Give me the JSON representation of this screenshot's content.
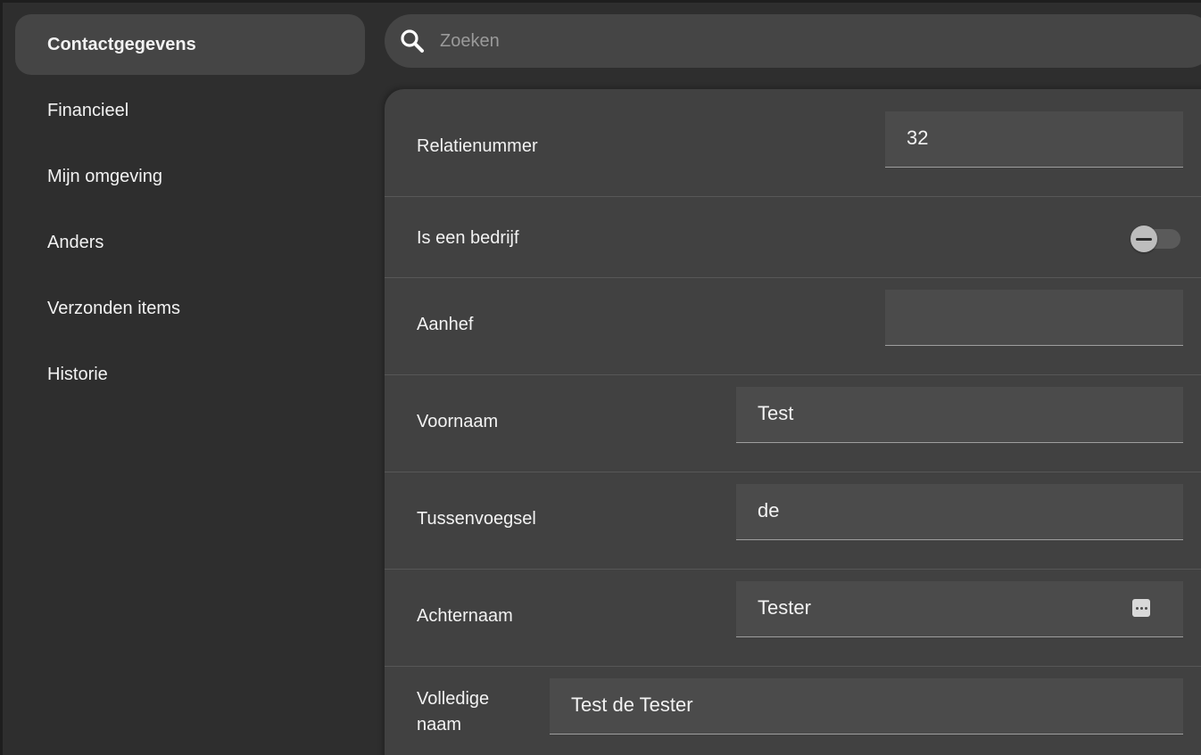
{
  "sidebar": {
    "items": [
      {
        "label": "Contactgegevens",
        "active": true
      },
      {
        "label": "Financieel",
        "active": false
      },
      {
        "label": "Mijn omgeving",
        "active": false
      },
      {
        "label": "Anders",
        "active": false
      },
      {
        "label": "Verzonden items",
        "active": false
      },
      {
        "label": "Historie",
        "active": false
      }
    ]
  },
  "search": {
    "placeholder": "Zoeken",
    "icon": "search-icon"
  },
  "form": {
    "relatienummer": {
      "label": "Relatienummer",
      "value": "32"
    },
    "is_bedrijf": {
      "label": "Is een bedrijf",
      "checked": false
    },
    "aanhef": {
      "label": "Aanhef",
      "value": ""
    },
    "voornaam": {
      "label": "Voornaam",
      "value": "Test"
    },
    "tussenvoegsel": {
      "label": "Tussenvoegsel",
      "value": "de"
    },
    "achternaam": {
      "label": "Achternaam",
      "value": "Tester",
      "icon": "more-icon"
    },
    "volledige_naam": {
      "label_line1": "Volledige",
      "label_line2": "naam",
      "value": "Test de Tester"
    }
  },
  "colors": {
    "background": "#2e2e2e",
    "panel": "#414141",
    "field": "#4b4b4b",
    "active_nav": "#454545"
  }
}
